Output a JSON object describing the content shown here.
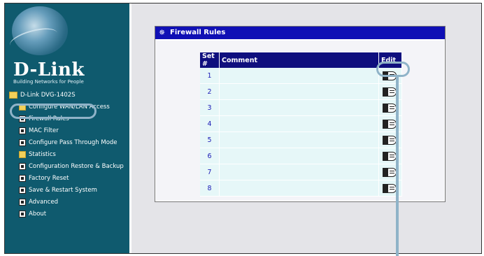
{
  "sidebar": {
    "brand": "D-Link",
    "tagline": "Building Networks for People",
    "root": "D-Link DVG-1402S",
    "items": [
      {
        "label": "Configure WAN/LAN Access",
        "icon": "folder-icon"
      },
      {
        "label": "Firewall Rules",
        "icon": "page-icon"
      },
      {
        "label": "MAC Filter",
        "icon": "page-icon"
      },
      {
        "label": "Configure Pass Through Mode",
        "icon": "page-icon"
      },
      {
        "label": "Statistics",
        "icon": "folder-icon"
      },
      {
        "label": "Configuration Restore & Backup",
        "icon": "page-icon"
      },
      {
        "label": "Factory Reset",
        "icon": "page-icon"
      },
      {
        "label": "Save & Restart System",
        "icon": "page-icon"
      },
      {
        "label": "Advanced",
        "icon": "page-icon"
      },
      {
        "label": "About",
        "icon": "page-icon"
      }
    ]
  },
  "panel": {
    "title": "Firewall Rules",
    "columns": {
      "set": "Set #",
      "comment": "Comment",
      "edit": "Edit"
    },
    "rows": [
      {
        "set": "1",
        "comment": ""
      },
      {
        "set": "2",
        "comment": ""
      },
      {
        "set": "3",
        "comment": ""
      },
      {
        "set": "4",
        "comment": ""
      },
      {
        "set": "5",
        "comment": ""
      },
      {
        "set": "6",
        "comment": ""
      },
      {
        "set": "7",
        "comment": ""
      },
      {
        "set": "8",
        "comment": ""
      }
    ]
  },
  "colors": {
    "sidebar_bg": "#0f5a6e",
    "header_bg": "#0f0fb5",
    "table_header_bg": "#0f0f7e",
    "row_bg": "#e6f7f8",
    "highlight": "#8fb3c8"
  }
}
